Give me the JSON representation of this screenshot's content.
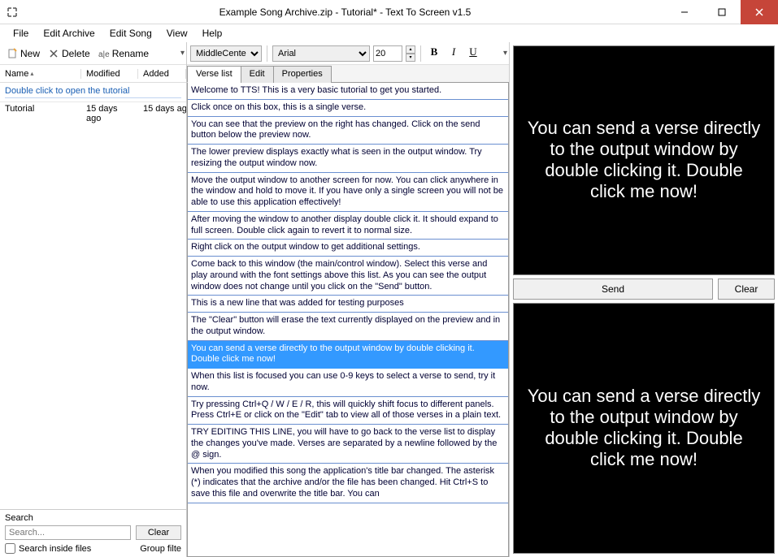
{
  "title": "Example Song Archive.zip - Tutorial* - Text To Screen v1.5",
  "menu": {
    "file": "File",
    "edit_archive": "Edit Archive",
    "edit_song": "Edit Song",
    "view": "View",
    "help": "Help"
  },
  "left_toolbar": {
    "new": "New",
    "delete": "Delete",
    "rename": "Rename"
  },
  "cols": {
    "name": "Name",
    "modified": "Modified",
    "added": "Added"
  },
  "hint": "Double click to open the tutorial",
  "files": [
    {
      "name": "Tutorial",
      "modified": "15 days ago",
      "added": "15 days ag"
    }
  ],
  "search": {
    "label": "Search",
    "placeholder": "Search...",
    "clear": "Clear",
    "inside": "Search inside files",
    "group": "Group filte"
  },
  "mid_toolbar": {
    "align": "MiddleCenter",
    "font": "Arial",
    "size": "20"
  },
  "tabs": {
    "verse": "Verse list",
    "edit": "Edit",
    "props": "Properties"
  },
  "verses": [
    "Welcome to TTS! This is a very basic tutorial to get you started.",
    "Click once on this box, this is a single verse.",
    "You can see that the preview on the right has changed. Click on the send button below the preview now.",
    "The lower preview displays exactly what is seen in the output window. Try resizing the output window now.",
    "Move the output window to another screen for now. You can click anywhere in the window and hold to move it. If you have only a single screen you will not be able to use this application effectively!",
    "After moving the window to another display double click it. It should expand to full screen. Double click again to revert it to normal size.",
    "Right click on the output window to get additional settings.",
    "Come back to this window (the main/control window).\nSelect this verse and play around with the font settings above this list. As you can see the output window does not change until you click on the \"Send\" button.",
    "This is a new line that was added for testing purposes",
    "The \"Clear\" button will erase the text currently displayed on the preview and in the output window.",
    "You can send a verse directly to the output window by double clicking it. Double click me now!",
    "When this list is focused you can use 0-9 keys to select a verse to send, try it now.",
    "Try pressing Ctrl+Q / W / E / R, this will quickly shift focus to different panels. Press Ctrl+E or click on the \"Edit\" tab to view all of those verses in a plain text.",
    "TRY EDITING THIS LINE, you will have to go back to the verse list to display the changes you've made. Verses are separated by a newline followed by the @ sign.",
    "When you modified this song the application's title bar changed. The asterisk (*) indicates that the archive and/or the file has been changed. Hit Ctrl+S to save this file and overwrite the title bar. You can"
  ],
  "selected_verse_index": 10,
  "preview_text": "You can send a verse directly to the output window by double clicking it. Double click me now!",
  "buttons": {
    "send": "Send",
    "clear": "Clear"
  }
}
